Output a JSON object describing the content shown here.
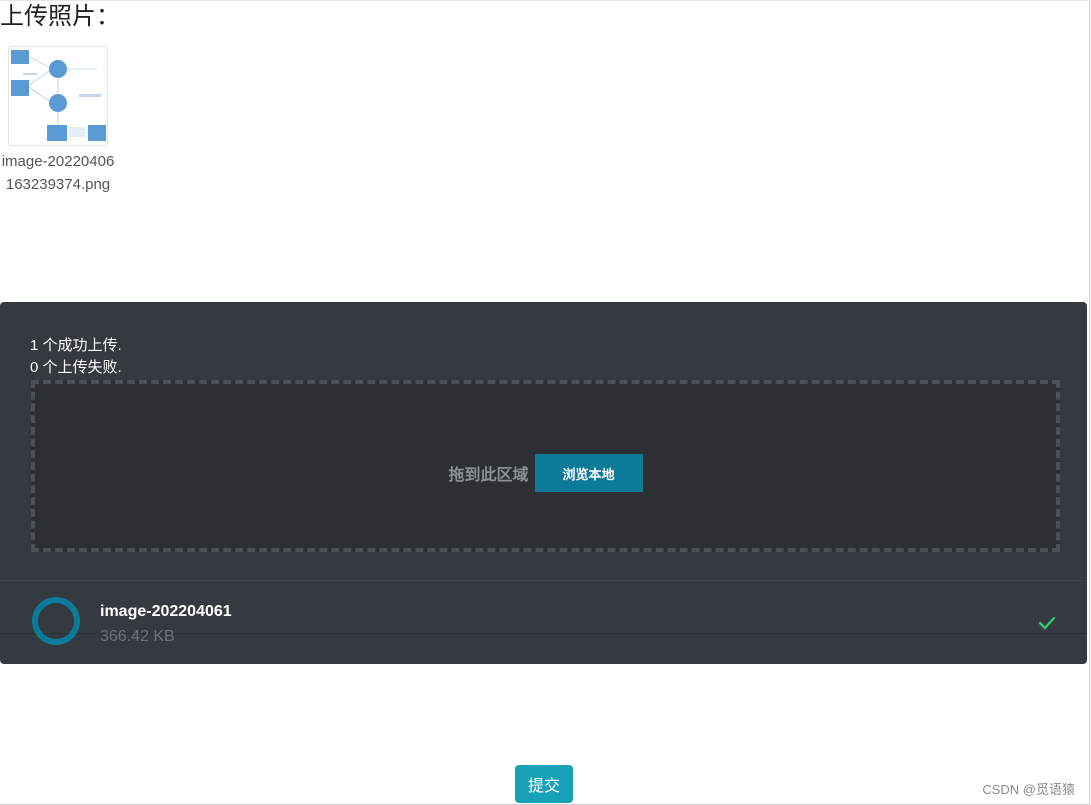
{
  "page": {
    "title": "上传照片："
  },
  "uploaded_files": [
    {
      "name": "image-20220406163239374.png"
    }
  ],
  "uploader": {
    "status_success": "1 个成功上传.",
    "status_failed": "0 个上传失败.",
    "drop_label": "拖到此区域",
    "browse_label": "浏览本地",
    "file": {
      "name": "image-202204061",
      "size": "366.42 KB",
      "status_icon": "check-icon"
    }
  },
  "actions": {
    "submit_label": "提交"
  },
  "watermark": "CSDN @觅语猿",
  "colors": {
    "panel_bg": "#343a40",
    "browse_button": "#0d7a98",
    "submit_button": "#17a2b8",
    "check": "#2ecc71"
  }
}
